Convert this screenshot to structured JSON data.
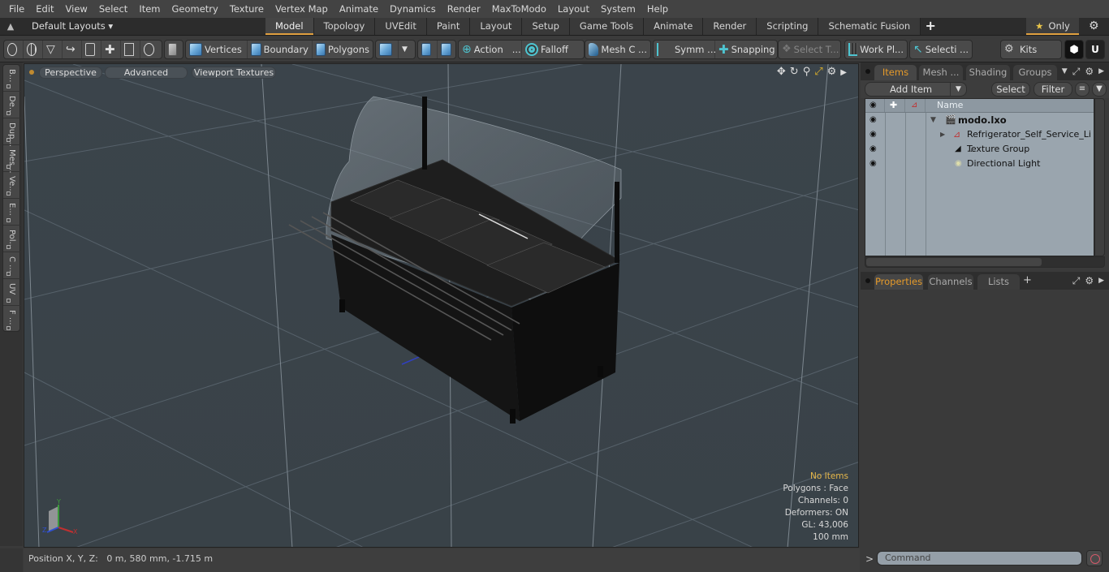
{
  "menu": [
    "File",
    "Edit",
    "View",
    "Select",
    "Item",
    "Geometry",
    "Texture",
    "Vertex Map",
    "Animate",
    "Dynamics",
    "Render",
    "MaxToModo",
    "Layout",
    "System",
    "Help"
  ],
  "layoutbar": {
    "layouts_label": "Default Layouts ▾",
    "tabs": [
      "Model",
      "Topology",
      "UVEdit",
      "Paint",
      "Layout",
      "Setup",
      "Game Tools",
      "Animate",
      "Render",
      "Scripting",
      "Schematic Fusion"
    ],
    "active_tab": "Model",
    "add_tab": "+",
    "only_label": "Only",
    "star": "★",
    "gear": "⚙"
  },
  "toolbar": {
    "vertices": "Vertices",
    "boundary": "Boundary",
    "polygons": "Polygons",
    "action": "Action",
    "action_more": "...",
    "falloff": "Falloff",
    "mesh_c": "Mesh C ...",
    "symm": "Symm ...",
    "snapping": "Snapping",
    "select_t": "Select T...",
    "work_pl": "Work Pl...",
    "selecti": "Selecti ...",
    "kits": "Kits"
  },
  "left_strip": [
    "B...",
    "De...",
    "Dup...",
    "Mes...",
    "Ve...",
    "E...",
    "Pol...",
    "C ...",
    "UV",
    "F ..."
  ],
  "viewport": {
    "view_mode": "Perspective",
    "shading": "Advanced",
    "textures": "Viewport Textures",
    "info": {
      "selection": "No Items",
      "polygons": "Polygons : Face",
      "channels": "Channels: 0",
      "deformers": "Deformers: ON",
      "gl": "GL: 43,006",
      "grid": "100 mm"
    },
    "axes": {
      "x": "X",
      "y": "Y",
      "z": "Z"
    }
  },
  "status": {
    "position_label": "Position X, Y, Z:",
    "position_value": "0 m, 580 mm, -1.715 m"
  },
  "items_panel": {
    "tabs": [
      "Items",
      "Mesh ...",
      "Shading",
      "Groups"
    ],
    "active_tab": "Items",
    "add_item": "Add Item",
    "select": "Select",
    "filter": "Filter",
    "column_name": "Name",
    "tree": [
      {
        "label": "modo.lxo",
        "level": 0,
        "bold": true,
        "icon": "scene-icon"
      },
      {
        "label": "Refrigerator_Self_Service_Li ...",
        "level": 1,
        "bold": false,
        "icon": "mesh-locator-icon"
      },
      {
        "label": "Texture Group",
        "level": 1,
        "bold": false,
        "icon": "texture-group-icon"
      },
      {
        "label": "Directional Light",
        "level": 1,
        "bold": false,
        "icon": "light-icon"
      }
    ]
  },
  "props_panel": {
    "tabs": [
      "Properties",
      "Channels",
      "Lists"
    ],
    "active_tab": "Properties",
    "add_tab": "+"
  },
  "command": {
    "prompt": ">",
    "placeholder": "Command"
  }
}
